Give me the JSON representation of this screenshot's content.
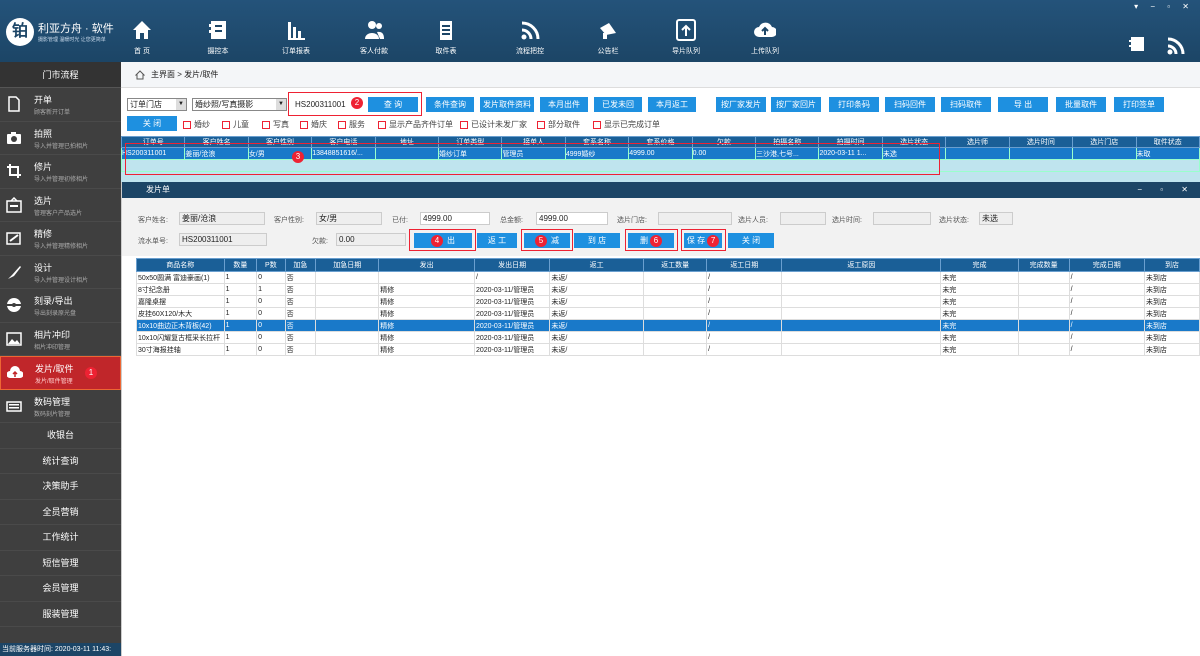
{
  "app": {
    "logo_char": "铂",
    "name": "利亚方舟 · 软件",
    "slogan": "摄影管理 温暖时光 让您更简单"
  },
  "window_controls": "▾ − ▫ ✕",
  "nav": [
    {
      "label": "首 页",
      "icon": "home-icon"
    },
    {
      "label": "摄控本",
      "icon": "book-icon"
    },
    {
      "label": "订单报表",
      "icon": "bar-chart-icon"
    },
    {
      "label": "客人付款",
      "icon": "people-icon"
    },
    {
      "label": "取件表",
      "icon": "clipboard-icon"
    },
    {
      "label": "流程把控",
      "icon": "wifi-icon"
    },
    {
      "label": "公告栏",
      "icon": "megaphone-icon"
    },
    {
      "label": "导片队列",
      "icon": "upload-queue-icon"
    },
    {
      "label": "上传队列",
      "icon": "cloud-upload-icon"
    }
  ],
  "sidebar": {
    "header": "门市流程",
    "items": [
      {
        "title": "开单",
        "sub": "顾客新开订单",
        "icon": "document-icon"
      },
      {
        "title": "拍照",
        "sub": "导入并管理已拍相片",
        "icon": "camera-icon"
      },
      {
        "title": "修片",
        "sub": "导入并管理初修相片",
        "icon": "crop-icon"
      },
      {
        "title": "选片",
        "sub": "管理客户产品选片",
        "icon": "select-icon"
      },
      {
        "title": "精修",
        "sub": "导入并管理精修相片",
        "icon": "retouch-icon"
      },
      {
        "title": "设计",
        "sub": "导入并管理设计相片",
        "icon": "brush-icon"
      },
      {
        "title": "刻录/导出",
        "sub": "导出刻录原光盘",
        "icon": "disc-icon"
      },
      {
        "title": "相片冲印",
        "sub": "相片冲印管理",
        "icon": "photo-icon"
      },
      {
        "title": "发片/取件",
        "sub": "发片/取件管理",
        "icon": "cloud-out-icon",
        "active": true
      },
      {
        "title": "数码管理",
        "sub": "数码刻片管理",
        "icon": "keyboard-icon"
      }
    ],
    "plain": [
      "收银台",
      "统计查询",
      "决策助手",
      "全员营销",
      "工作统计",
      "短信管理",
      "会员管理",
      "服装管理"
    ]
  },
  "status": "当前服务器时间: 2020-03-11 11:43:",
  "breadcrumb": "主界面 > 发片/取件",
  "filters": {
    "store_select": "订单门店",
    "package_select": "婚纱照/写真摄影",
    "search_value": "HS200311001",
    "badge2": "2",
    "buttons": [
      "查 询",
      "条件查询",
      "发片取件资料",
      "本月出件",
      "已发未回",
      "本月返工",
      "按厂家发片",
      "按厂家回片",
      "打印条码",
      "扫码回件",
      "扫码取件",
      "导 出",
      "批量取件",
      "打印签单"
    ],
    "close_label": "关 闭",
    "checks": [
      "婚纱",
      "儿童",
      "写真",
      "婚庆",
      "服务",
      "显示产品齐件订单",
      "已设计未发厂家",
      "部分取件",
      "显示已完成订单"
    ]
  },
  "order_table": {
    "headers": [
      "订单号",
      "客户姓名",
      "客户性别",
      "客户电话",
      "地址",
      "订单类型",
      "接单人",
      "套系名称",
      "套系价格",
      "欠款",
      "拍摄名称",
      "拍摄时间",
      "选片状态",
      "选片师",
      "选片时间",
      "选片门店",
      "取件状态"
    ],
    "row": [
      "HS200311001",
      "姜丽/沧浪",
      "女/男",
      "13848851616/...",
      "",
      "婚纱订单",
      "管理员",
      "4999婚纱",
      "4999.00",
      "0.00",
      "三沙港,七号...",
      "2020-03-11 1...",
      "未选",
      "",
      "",
      "",
      "未取"
    ],
    "badge3": "3"
  },
  "subwindow": {
    "title": "发片单",
    "controls": "− ▫ ✕",
    "labels": {
      "customer_name": "客户姓名:",
      "customer_gender": "客户性别:",
      "paid": "已付:",
      "total": "总金额:",
      "pick_store": "选片门店:",
      "pick_staff": "选片人员:",
      "pick_time": "选片时间:",
      "pick_status": "选片状态:",
      "serial": "流水单号:",
      "owed": "欠款:"
    },
    "values": {
      "customer_name": "姜丽/沧浪",
      "customer_gender": "女/男",
      "paid": "4999.00",
      "total": "4999.00",
      "pick_store": "",
      "pick_staff": "",
      "pick_time": "",
      "pick_status": "未选",
      "serial": "HS200311001",
      "owed": "0.00"
    },
    "buttons": [
      "出",
      "返 工",
      "减",
      "到 店",
      "删",
      "保 存",
      "关 闭"
    ],
    "badges": [
      "4",
      "5",
      "6",
      "7"
    ]
  },
  "detail": {
    "headers": [
      "商品名称",
      "数量",
      "P数",
      "加急",
      "加急日期",
      "发出",
      "发出日期",
      "返工",
      "返工数量",
      "返工日期",
      "返工原因",
      "完成",
      "完成数量",
      "完成日期",
      "到店"
    ],
    "rows": [
      [
        "50x50圆满 富迪豪画(1)",
        "1",
        "0",
        "否",
        "",
        "",
        "/",
        "未返/",
        "",
        "/",
        "",
        "未完",
        "",
        "/",
        "未到店"
      ],
      [
        "8寸纪念册",
        "1",
        "1",
        "否",
        "",
        "精修",
        "2020-03-11/管理员",
        "未返/",
        "",
        "/",
        "",
        "未完",
        "",
        "/",
        "未到店"
      ],
      [
        "嘉隆桌摆",
        "1",
        "0",
        "否",
        "",
        "精修",
        "2020-03-11/管理员",
        "未返/",
        "",
        "/",
        "",
        "未完",
        "",
        "/",
        "未到店"
      ],
      [
        "皮挂60X120/木大",
        "1",
        "0",
        "否",
        "",
        "精修",
        "2020-03-11/管理员",
        "未返/",
        "",
        "/",
        "",
        "未完",
        "",
        "/",
        "未到店"
      ],
      [
        "10x10曲边正木背板(42)",
        "1",
        "0",
        "否",
        "",
        "精修",
        "2020-03-11/管理员",
        "未返/",
        "",
        "/",
        "",
        "未完",
        "",
        "/",
        "未到店"
      ],
      [
        "10x10闪耀复古框采长拉杆",
        "1",
        "0",
        "否",
        "",
        "精修",
        "2020-03-11/管理员",
        "未返/",
        "",
        "/",
        "",
        "未完",
        "",
        "/",
        "未到店"
      ],
      [
        "30寸海报挂轴",
        "1",
        "0",
        "否",
        "",
        "精修",
        "2020-03-11/管理员",
        "未返/",
        "",
        "/",
        "",
        "未完",
        "",
        "/",
        "未到店"
      ]
    ],
    "selected_row": 4
  }
}
